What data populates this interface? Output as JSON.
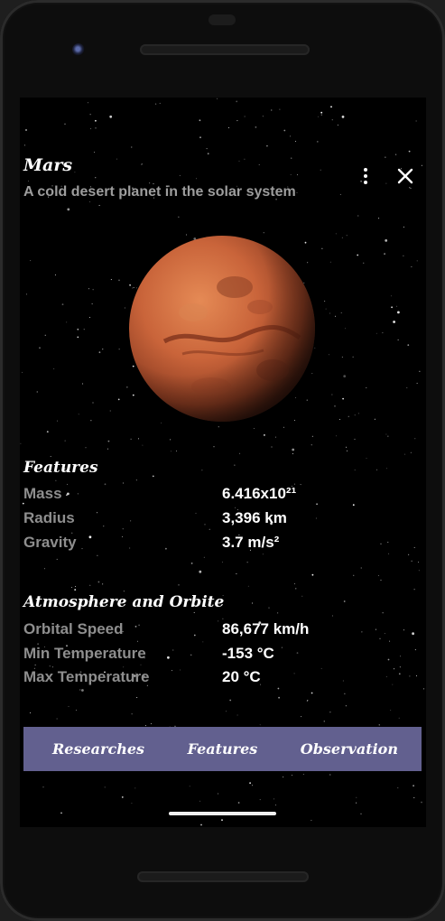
{
  "header": {
    "title": "Mars",
    "subtitle": "A cold desert planet in the solar system"
  },
  "actions": {
    "menu_icon": "more-vert-icon",
    "close_icon": "close-icon"
  },
  "features": {
    "title": "Features",
    "rows": [
      {
        "label": "Mass",
        "value": "6.416x10²¹"
      },
      {
        "label": "Radius",
        "value": "3,396 km"
      },
      {
        "label": "Gravity",
        "value": "3.7 m/s²"
      }
    ]
  },
  "atmosphere": {
    "title": "Atmosphere and Orbite",
    "rows": [
      {
        "label": "Orbital Speed",
        "value": "86,677 km/h"
      },
      {
        "label": "Min Temperature",
        "value": "-153 °C"
      },
      {
        "label": "Max Temperature",
        "value": "20 °C"
      }
    ]
  },
  "bottom_nav": {
    "items": [
      {
        "label": "Researches"
      },
      {
        "label": "Features"
      },
      {
        "label": "Observation"
      }
    ]
  },
  "colors": {
    "nav_background": "#62608f",
    "label_gray": "#8e8e8e",
    "background": "#000000"
  }
}
